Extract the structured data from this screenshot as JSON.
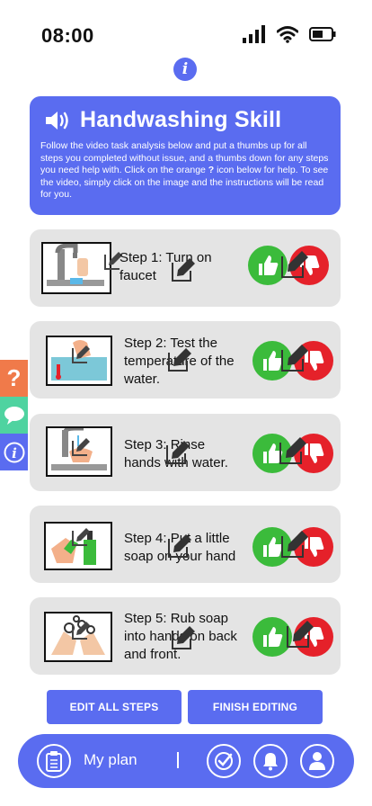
{
  "status": {
    "time": "08:00"
  },
  "header": {
    "title": "Handwashing Skill",
    "text_1": "Follow the video task analysis below and put a thumbs up for all steps you completed without issue, and a thumbs down for any steps you need help with. Click on the orange ",
    "text_bold": "?",
    "text_2": " icon below for help. To see the video, simply click on the image and the instructions will be read for you."
  },
  "side_tabs": {
    "help_glyph": "?",
    "info_glyph": "i"
  },
  "steps": [
    {
      "label": "Step 1: Turn on faucet",
      "image": "faucet-icon"
    },
    {
      "label": "Step 2: Test the temperature of the water.",
      "image": "water-temperature-icon"
    },
    {
      "label": "Step 3: Rinse hands with water.",
      "image": "rinse-hands-icon"
    },
    {
      "label": "Step 4: Put a little soap on your hand",
      "image": "soap-icon"
    },
    {
      "label": "Step 5: Rub soap into hands on back and front.",
      "image": "rub-hands-icon"
    }
  ],
  "buttons": {
    "edit_all": "EDIT ALL STEPS",
    "finish": "FINISH EDITING"
  },
  "bottom_nav": {
    "plan_label": "My plan",
    "divider": "|"
  },
  "colors": {
    "primary": "#5a6cf0",
    "thumb_up": "#3bbb3b",
    "thumb_down": "#e5212a",
    "help_tab": "#f07a4a",
    "chat_tab": "#4fd3a0",
    "card_bg": "#e4e4e4"
  },
  "icons": [
    "signal-icon",
    "wifi-icon",
    "battery-icon",
    "info-icon",
    "speaker-icon",
    "help-icon",
    "chat-icon",
    "edit-icon",
    "thumbs-up-icon",
    "thumbs-down-icon",
    "clipboard-icon",
    "check-icon",
    "bell-icon",
    "user-icon"
  ]
}
